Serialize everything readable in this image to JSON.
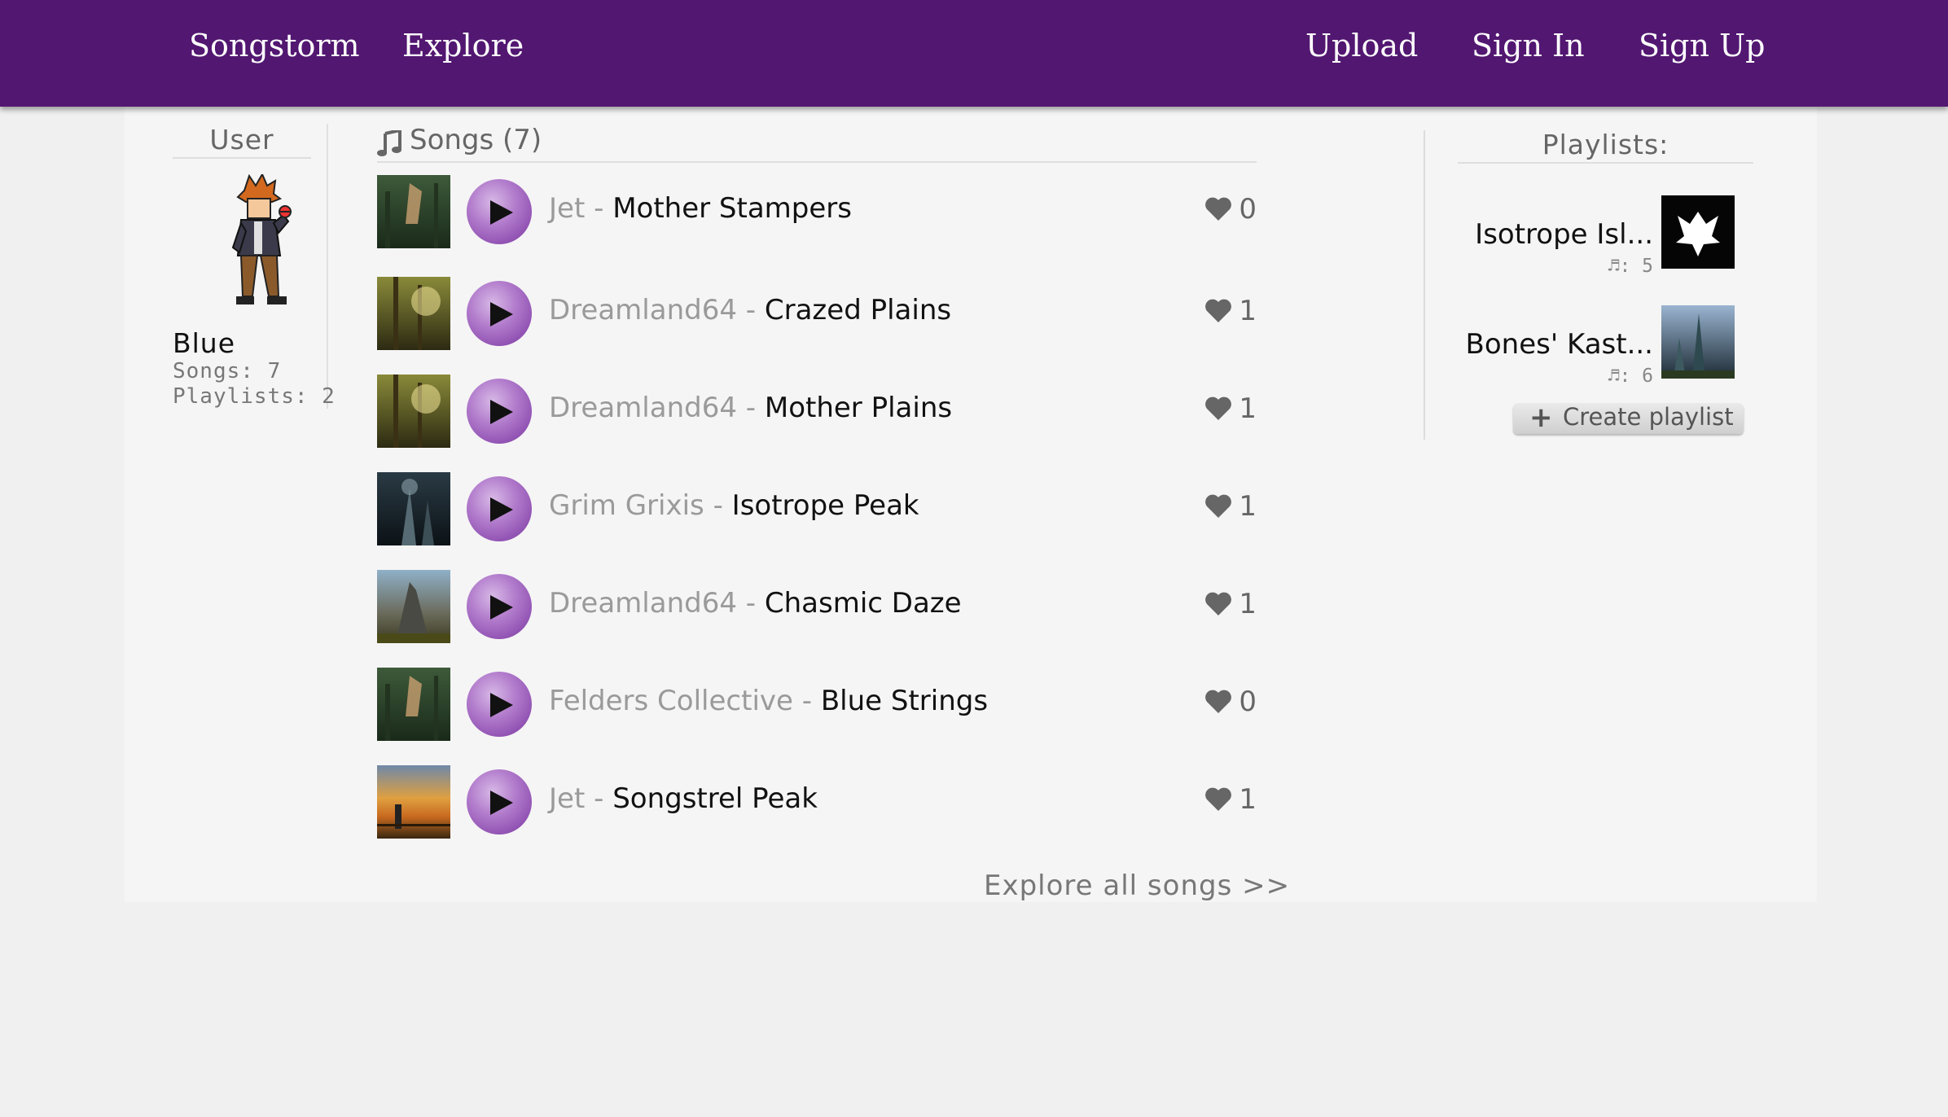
{
  "nav": {
    "brand": "Songstorm",
    "explore": "Explore",
    "upload": "Upload",
    "sign_in": "Sign In",
    "sign_up": "Sign Up"
  },
  "user": {
    "header": "User",
    "name": "Blue",
    "songs": "Songs: 7",
    "playlists": "Playlists: 2"
  },
  "songs": {
    "header": "Songs (7)",
    "items": [
      {
        "artist": "Jet",
        "sep": "-",
        "title": "Mother Stampers",
        "likes": "0"
      },
      {
        "artist": "Dreamland64",
        "sep": "-",
        "title": "Crazed Plains",
        "likes": "1"
      },
      {
        "artist": "Dreamland64",
        "sep": "-",
        "title": "Mother Plains",
        "likes": "1"
      },
      {
        "artist": "Grim Grixis",
        "sep": "-",
        "title": "Isotrope Peak",
        "likes": "1"
      },
      {
        "artist": "Dreamland64",
        "sep": "-",
        "title": "Chasmic Daze",
        "likes": "1"
      },
      {
        "artist": "Felders Collective",
        "sep": "-",
        "title": "Blue Strings",
        "likes": "0"
      },
      {
        "artist": "Jet",
        "sep": "-",
        "title": "Songstrel Peak",
        "likes": "1"
      }
    ],
    "explore_all": "Explore all songs >>"
  },
  "playlists": {
    "header": "Playlists:",
    "items": [
      {
        "name": "Isotrope Isl...",
        "count": ": 5"
      },
      {
        "name": "Bones' Kast...",
        "count": ": 6"
      }
    ],
    "create": "Create playlist"
  },
  "colors": {
    "navbar": "#521771",
    "play_button": "#9b5cbc"
  },
  "icons": {
    "song_header": "music-note-icon",
    "play": "play-icon",
    "like": "heart-icon",
    "playlist_count": "music-note-icon",
    "create": "plus-icon"
  }
}
